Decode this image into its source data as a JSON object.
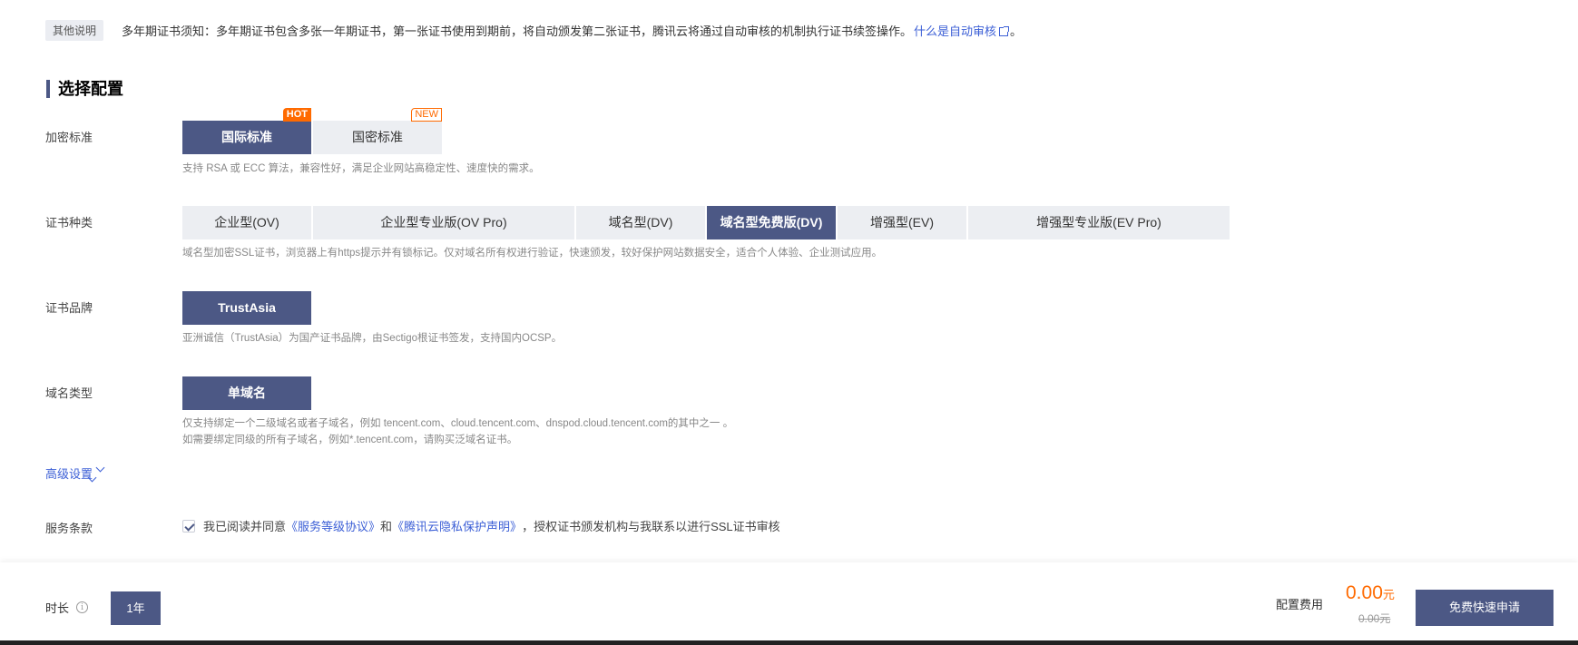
{
  "note": {
    "tag": "其他说明",
    "text": "多年期证书须知：多年期证书包含多张一年期证书，第一张证书使用到期前，将自动颁发第二张证书，腾讯云将通过自动审核的机制执行证书续签操作。",
    "link": "什么是自动审核",
    "end": "。"
  },
  "section_title": "选择配置",
  "encryption": {
    "label": "加密标准",
    "options": [
      {
        "label": "国际标准",
        "badge": "HOT",
        "selected": true
      },
      {
        "label": "国密标准",
        "badge": "NEW",
        "selected": false
      }
    ],
    "desc": "支持 RSA 或 ECC 算法，兼容性好，满足企业网站高稳定性、速度快的需求。"
  },
  "cert_type": {
    "label": "证书种类",
    "options": [
      {
        "label": "企业型(OV)",
        "selected": false
      },
      {
        "label": "企业型专业版(OV Pro)",
        "selected": false
      },
      {
        "label": "域名型(DV)",
        "selected": false
      },
      {
        "label": "域名型免费版(DV)",
        "selected": true
      },
      {
        "label": "增强型(EV)",
        "selected": false
      },
      {
        "label": "增强型专业版(EV Pro)",
        "selected": false
      }
    ],
    "desc": "域名型加密SSL证书，浏览器上有https提示并有锁标记。仅对域名所有权进行验证，快速颁发，较好保护网站数据安全，适合个人体验、企业测试应用。"
  },
  "brand": {
    "label": "证书品牌",
    "options": [
      {
        "label": "TrustAsia",
        "selected": true
      }
    ],
    "desc": "亚洲诚信（TrustAsia）为国产证书品牌，由Sectigo根证书签发，支持国内OCSP。"
  },
  "domain_type": {
    "label": "域名类型",
    "options": [
      {
        "label": "单域名",
        "selected": true
      }
    ],
    "desc1": "仅支持绑定一个二级域名或者子域名，例如 tencent.com、cloud.tencent.com、dnspod.cloud.tencent.com的其中之一 。",
    "desc2": "如需要绑定同级的所有子域名，例如*.tencent.com，请购买泛域名证书。"
  },
  "advanced": "高级设置",
  "terms": {
    "label": "服务条款",
    "prefix": "我已阅读并同意",
    "link1": "《服务等级协议》",
    "and": "和",
    "link2": "《腾讯云隐私保护声明》",
    "suffix": "，授权证书颁发机构与我联系以进行SSL证书审核",
    "checked": true
  },
  "footer": {
    "duration_label": "时长",
    "duration_value": "1年",
    "fee_label": "配置费用",
    "price": "0.00",
    "price_unit": "元",
    "original_price": "0.00元",
    "apply_button": "免费快速申请"
  },
  "colors": {
    "primary": "#4c5885",
    "link": "#3c5fd6",
    "price": "#ff6a00"
  }
}
